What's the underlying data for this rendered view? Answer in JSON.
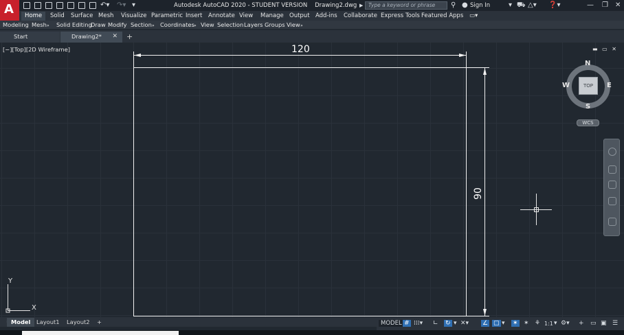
{
  "titlebar": {
    "title": "Autodesk AutoCAD 2020 - STUDENT VERSION",
    "filename": "Drawing2.dwg",
    "search_placeholder": "Type a keyword or phrase",
    "sign_in": "Sign In"
  },
  "ribbon": {
    "tabs": [
      "Home",
      "Solid",
      "Surface",
      "Mesh",
      "Visualize",
      "Parametric",
      "Insert",
      "Annotate",
      "View",
      "Manage",
      "Output",
      "Add-ins",
      "Collaborate",
      "Express Tools",
      "Featured Apps"
    ],
    "active_tab": "Home"
  },
  "toolbar": {
    "items": [
      "Modeling",
      "Mesh",
      "Solid Editing",
      "Draw",
      "Modify",
      "Section",
      "Coordinates",
      "View",
      "Selection",
      "Layers",
      "Groups",
      "View"
    ]
  },
  "file_tabs": {
    "start": "Start",
    "drawing": "Drawing2*",
    "close": "✕",
    "add": "+"
  },
  "viewport": {
    "label": "[−][Top][2D Wireframe]",
    "controls": "▬ ▭ ✕"
  },
  "drawing": {
    "dimension_horizontal": "120",
    "dimension_vertical": "90"
  },
  "viewcube": {
    "top": "TOP",
    "north": "N",
    "south": "S",
    "east": "E",
    "west": "W",
    "wcs": "WCS"
  },
  "ucs": {
    "x": "X",
    "y": "Y"
  },
  "layout_tabs": {
    "model": "Model",
    "layout1": "Layout1",
    "layout2": "Layout2",
    "add": "+"
  },
  "statusbar": {
    "model": "MODEL",
    "scale": "1:1"
  },
  "colors": {
    "accent": "#2f6fb3",
    "logo": "#c8202b",
    "background": "#212830"
  }
}
